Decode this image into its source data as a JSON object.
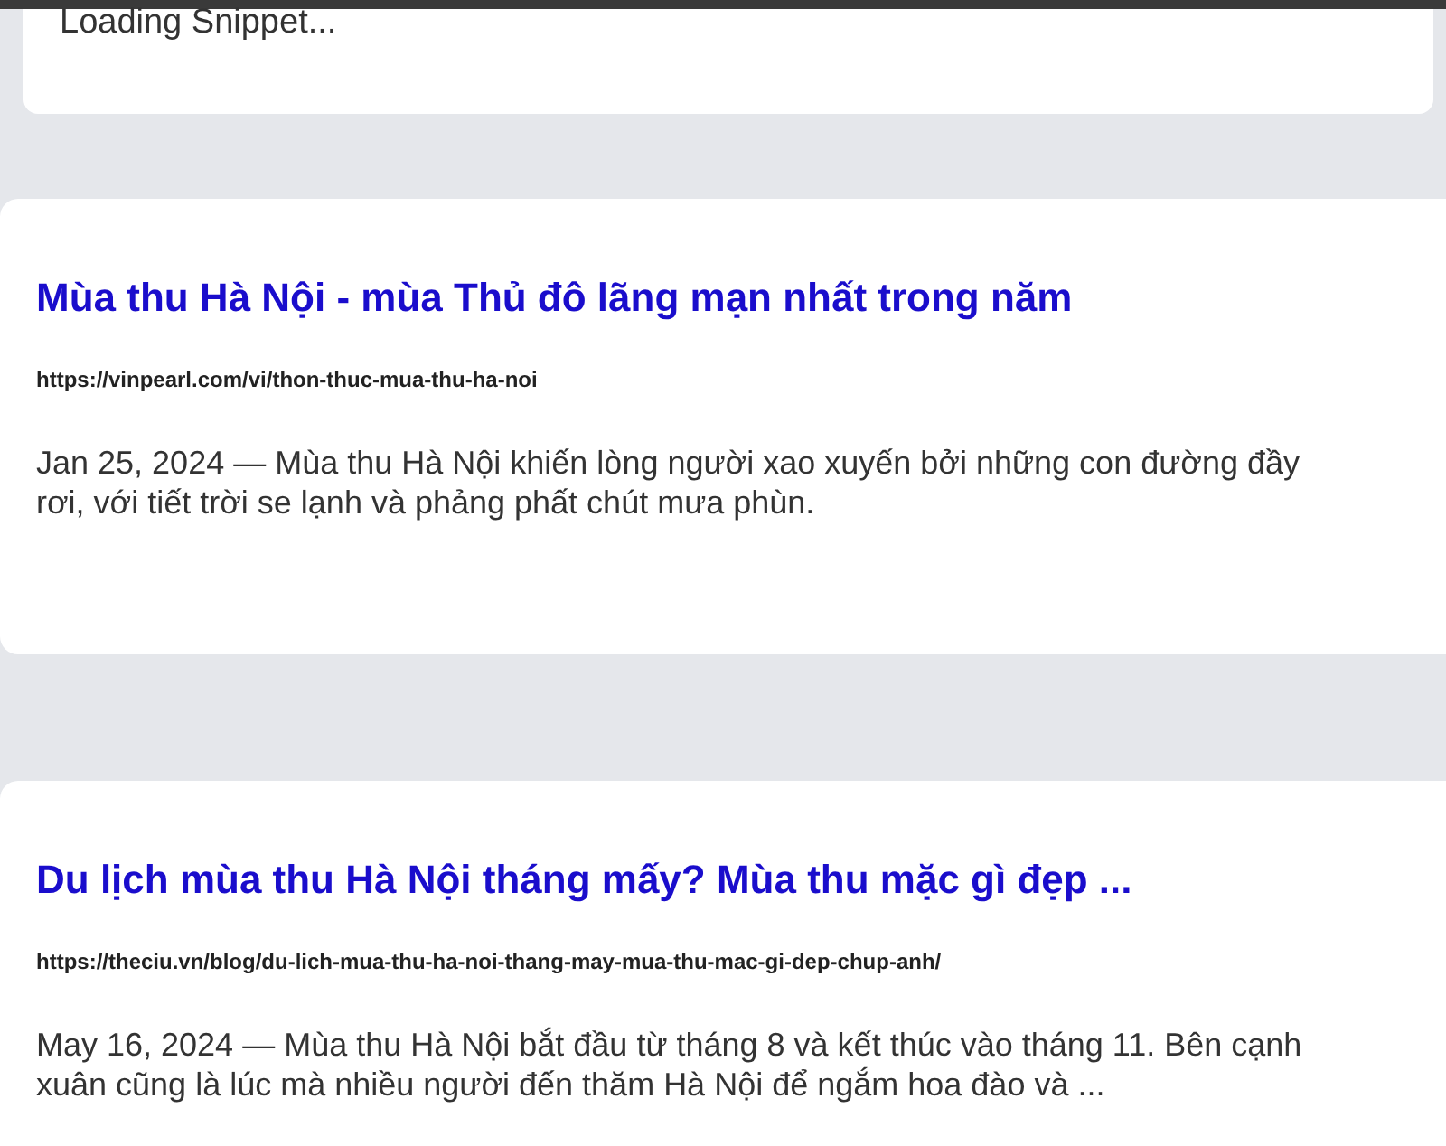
{
  "loading_card": {
    "text": "Loading Snippet..."
  },
  "results": [
    {
      "title": "Mùa thu Hà Nội - mùa Thủ đô lãng mạn nhất trong năm",
      "url": "https://vinpearl.com/vi/thon-thuc-mua-thu-ha-noi",
      "snippet_lines": [
        "Jan 25, 2024 — Mùa thu Hà Nội khiến lòng người xao xuyến bởi những con đường đầy",
        "rơi, với tiết trời se lạnh và phảng phất chút mưa phùn."
      ]
    },
    {
      "title": "Du lịch mùa thu Hà Nội tháng mấy? Mùa thu mặc gì đẹp ...",
      "url": "https://theciu.vn/blog/du-lich-mua-thu-ha-noi-thang-may-mua-thu-mac-gi-dep-chup-anh/",
      "snippet_lines": [
        "May 16, 2024 — Mùa thu Hà Nội bắt đầu từ tháng 8 và kết thúc vào tháng 11. Bên cạnh",
        "xuân cũng là lúc mà nhiều người đến thăm Hà Nội để ngắm hoa đào và ..."
      ]
    }
  ]
}
